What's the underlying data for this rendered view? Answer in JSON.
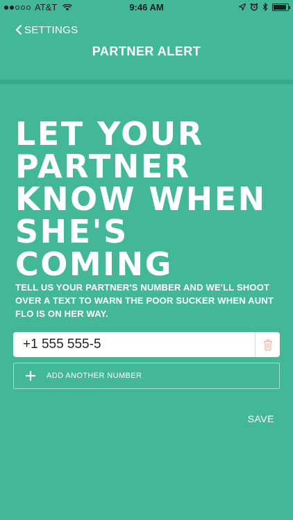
{
  "status_bar": {
    "carrier": "AT&T",
    "time": "9:46 AM",
    "signal_bars_filled": 2,
    "signal_bars_total": 5,
    "battery_level": 0.9
  },
  "nav": {
    "back_label": "SETTINGS",
    "title": "PARTNER ALERT"
  },
  "headline": {
    "lines": [
      "LET YOUR",
      "PARTNER",
      "KNOW WHEN",
      "SHE'S",
      "COMING"
    ]
  },
  "description": "TELL US YOUR PARTNER'S NUMBER AND WE'LL SHOOT OVER A TEXT TO WARN THE POOR SUCKER WHEN AUNT FLO IS ON HER WAY.",
  "phone": {
    "value": "+1 555 555-5"
  },
  "add_number_label": "ADD ANOTHER NUMBER",
  "save_label": "SAVE",
  "colors": {
    "background": "#42b899",
    "divider": "#3aa88b",
    "trash_icon": "#f2b59c"
  },
  "icons": {
    "back": "chevron-left-icon",
    "delete": "trash-icon",
    "add": "plus-icon",
    "location": "location-arrow-icon",
    "alarm": "alarm-clock-icon",
    "bluetooth": "bluetooth-icon",
    "battery": "battery-icon",
    "wifi": "wifi-icon"
  }
}
